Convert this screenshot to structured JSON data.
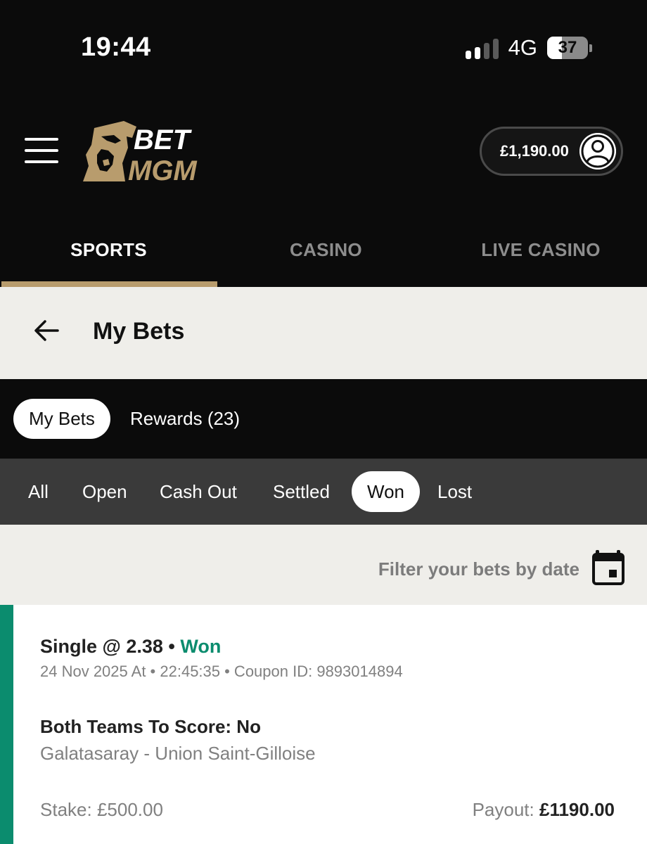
{
  "status_bar": {
    "time": "19:44",
    "network": "4G",
    "battery": "37",
    "battery_level": 0.37
  },
  "header": {
    "logo_text_top": "BET",
    "logo_text_bottom": "MGM",
    "balance": "£1,190.00",
    "brand_color": "#b89c6d"
  },
  "product_tabs": [
    {
      "label": "SPORTS",
      "active": true
    },
    {
      "label": "CASINO",
      "active": false
    },
    {
      "label": "LIVE CASINO",
      "active": false
    }
  ],
  "page": {
    "title": "My Bets"
  },
  "bets_tabs": [
    {
      "label": "My Bets",
      "active": true
    },
    {
      "label": "Rewards (23)",
      "active": false
    }
  ],
  "filters": [
    {
      "label": "All",
      "active": false
    },
    {
      "label": "Open",
      "active": false
    },
    {
      "label": "Cash Out",
      "active": false
    },
    {
      "label": "Settled",
      "active": false
    },
    {
      "label": "Won",
      "active": true
    },
    {
      "label": "Lost",
      "active": false
    }
  ],
  "date_filter": {
    "label": "Filter your bets by date"
  },
  "bet": {
    "type": "Single @ 2.38",
    "separator": " • ",
    "status": "Won",
    "meta": "24 Nov 2025 At • 22:45:35 • Coupon ID: 9893014894",
    "market": "Both Teams To Score: No",
    "event": "Galatasaray - Union Saint-Gilloise",
    "stake_label": "Stake: ",
    "stake_value": "£500.00",
    "payout_label": "Payout: ",
    "payout_value": "£1190.00",
    "status_color": "#0b8c6e"
  }
}
